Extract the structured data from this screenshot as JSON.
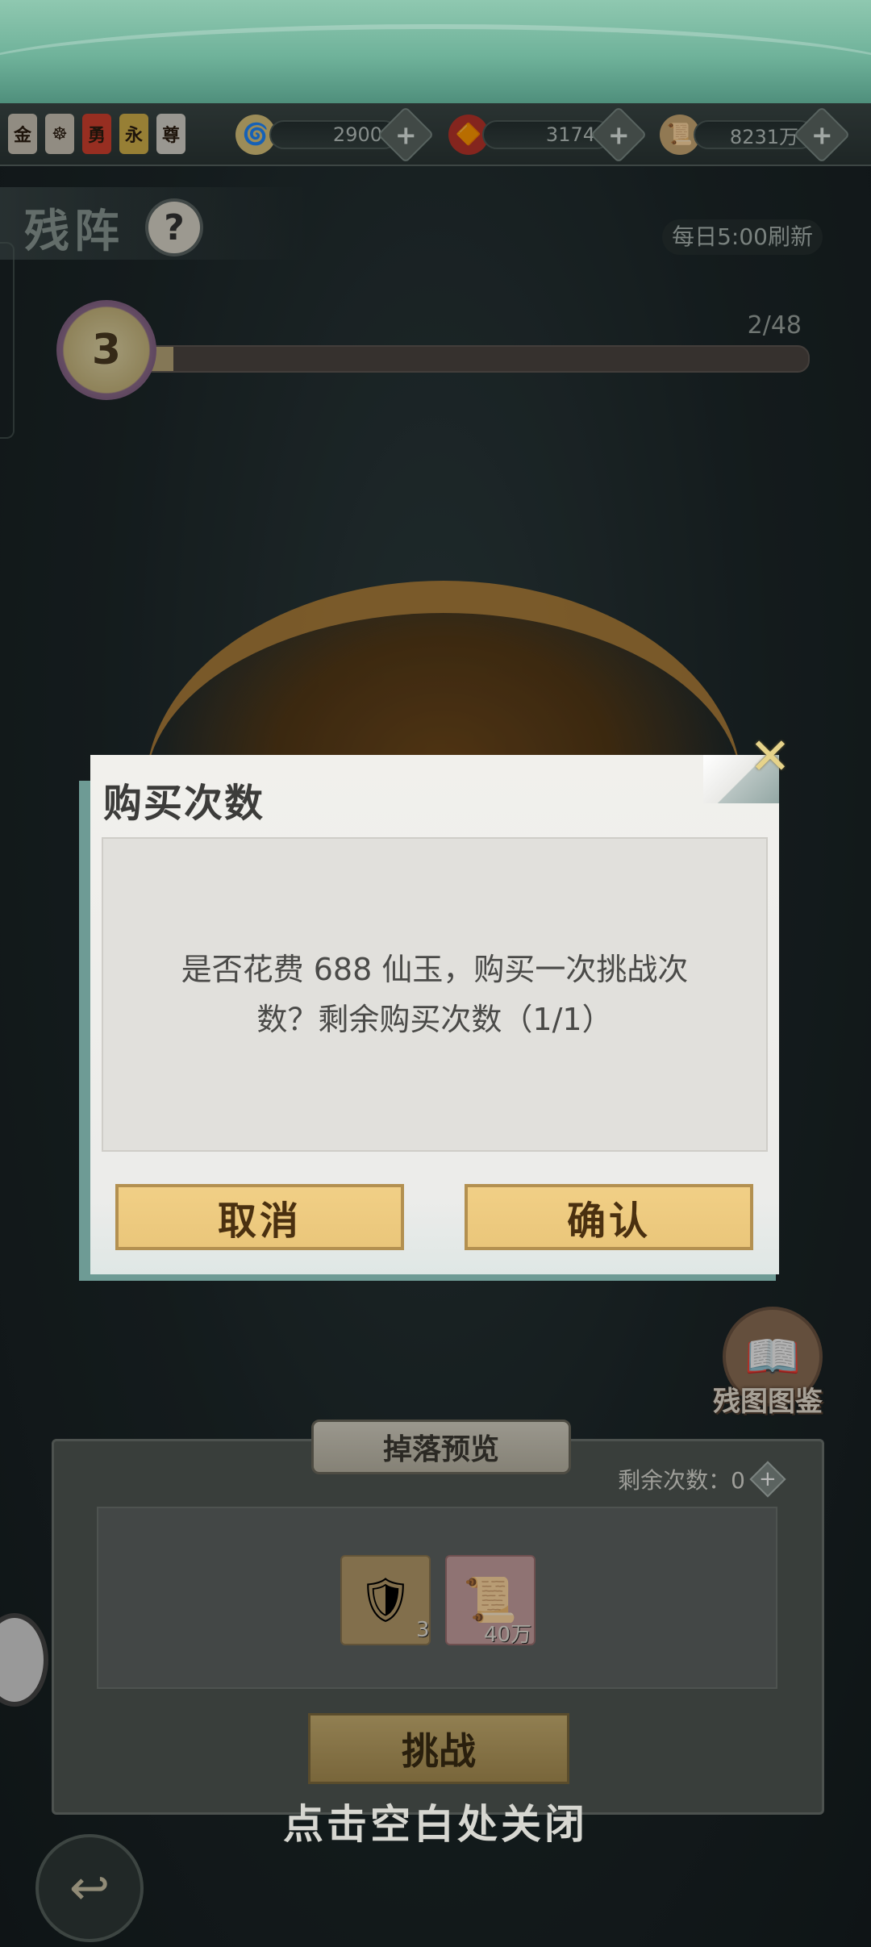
{
  "resource_bar": {
    "badges": [
      {
        "label": "金",
        "color": "#c9c2b4"
      },
      {
        "label": "☸",
        "color": "#c9c2b4"
      },
      {
        "label": "勇",
        "color": "#d1402e"
      },
      {
        "label": "永",
        "color": "#d2b04a"
      },
      {
        "label": "尊",
        "color": "#d5d1c9"
      }
    ],
    "currencies": [
      {
        "icon": "jade-swirl-icon",
        "glyph": "🌀",
        "value": "2900"
      },
      {
        "icon": "red-crystal-icon",
        "glyph": "🔶",
        "value": "3174"
      },
      {
        "icon": "token-card-icon",
        "glyph": "📜",
        "value": "8231万"
      }
    ],
    "plus_glyph": "+"
  },
  "header": {
    "title": "残阵",
    "help_glyph": "?",
    "refresh_note": "每日5:00刷新"
  },
  "progress": {
    "level": "3",
    "text": "2/48",
    "fraction": 0.04
  },
  "side": {
    "codex_label": "残图图鉴"
  },
  "drop_preview": {
    "header": "掉落预览",
    "remaining_label": "剩余次数：0",
    "items": [
      {
        "name": "bracer-item",
        "glyph": "🛡",
        "count": "3",
        "bg": "#b49a6a"
      },
      {
        "name": "scroll-item",
        "glyph": "📜",
        "count": "40万",
        "bg": "#c6a0a0"
      }
    ],
    "challenge_label": "挑战"
  },
  "close_hint": "点击空白处关闭",
  "dialog": {
    "title": "购买次数",
    "message_line1": "是否花费 688 仙玉，购买一次挑战次",
    "message_line2": "数？剩余购买次数（1/1）",
    "cancel_label": "取消",
    "confirm_label": "确认",
    "close_glyph": "✕"
  },
  "colors": {
    "accent_gold": "#eac67a",
    "teal": "#6e9b95"
  }
}
